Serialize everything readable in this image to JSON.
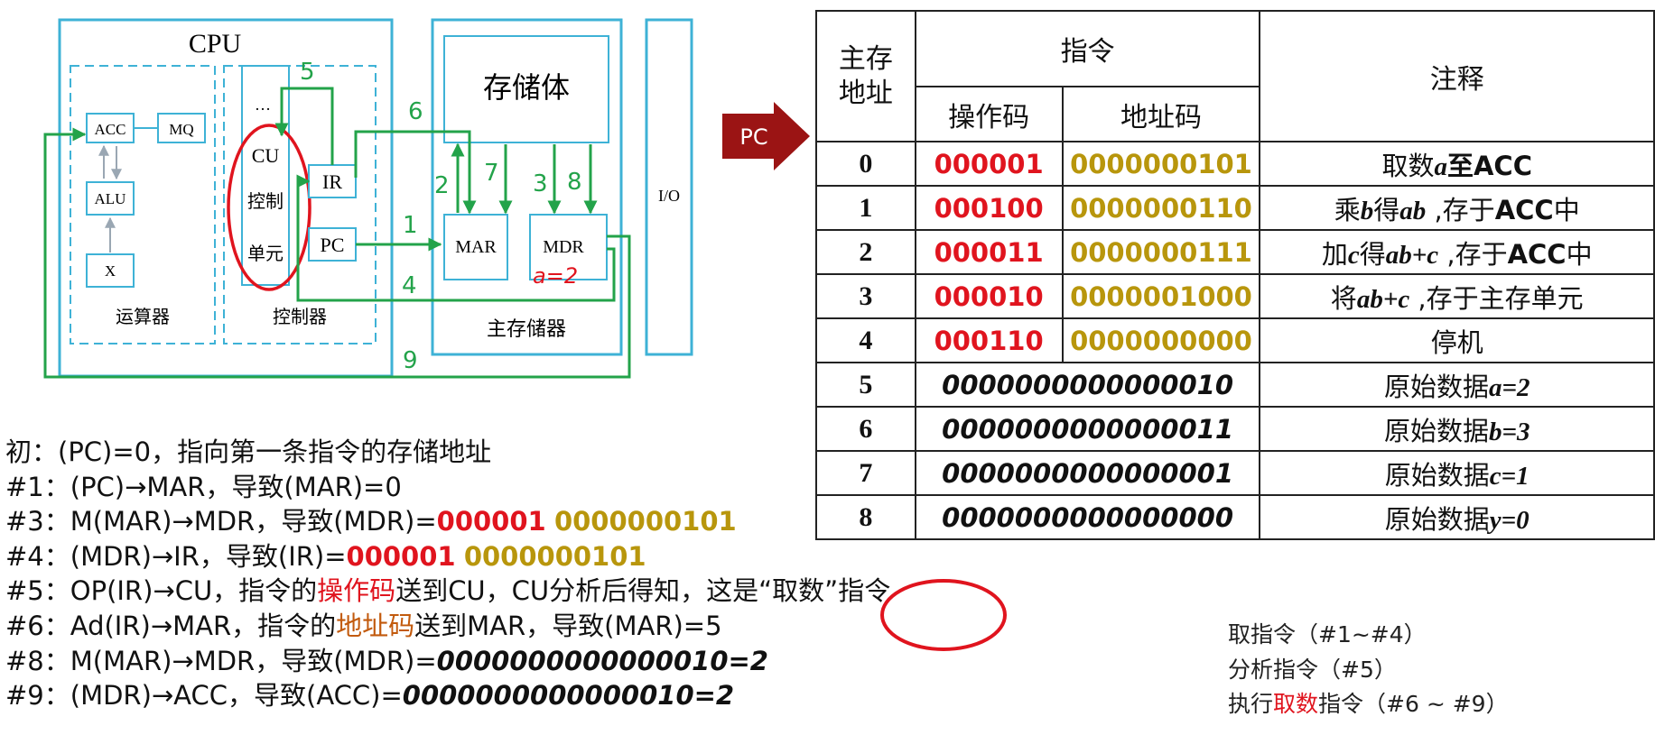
{
  "diagram": {
    "cpu_label": "CPU",
    "acc": "ACC",
    "mq": "MQ",
    "alu": "ALU",
    "x": "X",
    "alu_unit_label": "运算器",
    "cu_lines": [
      "CU",
      "控制",
      "单元"
    ],
    "cu_dots": "…",
    "ir": "IR",
    "pc": "PC",
    "control_unit_label": "控制器",
    "storage_body": "存储体",
    "mar": "MAR",
    "mdr": "MDR",
    "main_memory_label": "主存储器",
    "io": "I/O",
    "handwritten_note": "a=2",
    "pc_arrow_label": "PC",
    "step_numbers": [
      "1",
      "2",
      "3",
      "4",
      "5",
      "6",
      "7",
      "8",
      "9"
    ],
    "colors": {
      "box_blue": "#3eb2d6",
      "path_green": "#23a34a",
      "annotation_red": "#e0141e",
      "pc_arrow": "#9b1414"
    }
  },
  "table": {
    "headers": {
      "address": "主存地址",
      "instruction": "指令",
      "opcode": "操作码",
      "addrcode": "地址码",
      "note": "注释"
    },
    "rows": [
      {
        "addr": "0",
        "op": "000001",
        "ad": "0000000101",
        "note": [
          [
            "pre",
            "取数"
          ],
          [
            "em",
            "a"
          ],
          [
            "b",
            "至ACC"
          ]
        ]
      },
      {
        "addr": "1",
        "op": "000100",
        "ad": "0000000110",
        "note": [
          [
            "pre",
            "乘"
          ],
          [
            "em",
            "b"
          ],
          [
            "pre",
            "得"
          ],
          [
            "em",
            "ab"
          ],
          [
            "pre",
            " ,存于"
          ],
          [
            "b",
            "ACC"
          ],
          [
            "pre",
            "中"
          ]
        ]
      },
      {
        "addr": "2",
        "op": "000011",
        "ad": "0000000111",
        "note": [
          [
            "pre",
            "加"
          ],
          [
            "em",
            "c"
          ],
          [
            "pre",
            "得"
          ],
          [
            "em",
            "ab+c"
          ],
          [
            "pre",
            " ,存于"
          ],
          [
            "b",
            "ACC"
          ],
          [
            "pre",
            "中"
          ]
        ]
      },
      {
        "addr": "3",
        "op": "000010",
        "ad": "0000001000",
        "note": [
          [
            "pre",
            "将"
          ],
          [
            "em",
            "ab+c"
          ],
          [
            "pre",
            " ,存于主存单元"
          ]
        ]
      },
      {
        "addr": "4",
        "op": "000110",
        "ad": "0000000000",
        "note": [
          [
            "pre",
            "停机"
          ]
        ]
      },
      {
        "addr": "5",
        "data": "0000000000000010",
        "note": [
          [
            "pre",
            "原始数据"
          ],
          [
            "em",
            "a=2"
          ]
        ]
      },
      {
        "addr": "6",
        "data": "0000000000000011",
        "note": [
          [
            "pre",
            "原始数据"
          ],
          [
            "em",
            "b=3"
          ]
        ]
      },
      {
        "addr": "7",
        "data": "0000000000000001",
        "note": [
          [
            "pre",
            "原始数据"
          ],
          [
            "em",
            "c=1"
          ]
        ]
      },
      {
        "addr": "8",
        "data": "0000000000000000",
        "note": [
          [
            "pre",
            "原始数据"
          ],
          [
            "em",
            "y=0"
          ]
        ]
      }
    ]
  },
  "steps": [
    [
      [
        "t",
        "初：(PC)=0，指向第一条指令的存储地址"
      ]
    ],
    [
      [
        "t",
        "#1：(PC)→MAR，导致(MAR)=0"
      ]
    ],
    [
      [
        "t",
        "#3：M(MAR)→MDR，导致(MDR)="
      ],
      [
        "red-b",
        "000001"
      ],
      [
        "t",
        " "
      ],
      [
        "gold-b",
        "0000000101"
      ]
    ],
    [
      [
        "t",
        "#4：(MDR)→IR，导致(IR)="
      ],
      [
        "red-b",
        "000001"
      ],
      [
        "t",
        " "
      ],
      [
        "gold-b",
        "0000000101"
      ]
    ],
    [
      [
        "t",
        "#5：OP(IR)→CU，指令的"
      ],
      [
        "red",
        "操作码"
      ],
      [
        "t",
        "送到CU，CU分析后得知，这是"
      ],
      [
        "circled",
        "“取数”"
      ],
      [
        "t",
        "指令"
      ]
    ],
    [
      [
        "t",
        "#6：Ad(IR)→MAR，指令的"
      ],
      [
        "orange",
        "地址码"
      ],
      [
        "t",
        "送到MAR，导致(MAR)=5"
      ]
    ],
    [
      [
        "t",
        "#8：M(MAR)→MDR，导致(MDR)="
      ],
      [
        "bi",
        "0000000000000010=2"
      ]
    ],
    [
      [
        "t",
        "#9：(MDR)→ACC，导致(ACC)="
      ],
      [
        "bi",
        "0000000000000010=2"
      ]
    ]
  ],
  "summary": [
    [
      [
        "t",
        "取指令（#1~#4）"
      ]
    ],
    [
      [
        "t",
        "分析指令（#5）"
      ]
    ],
    [
      [
        "t",
        "执行"
      ],
      [
        "red",
        "取数"
      ],
      [
        "t",
        "指令（#6 ~ #9）"
      ]
    ]
  ]
}
